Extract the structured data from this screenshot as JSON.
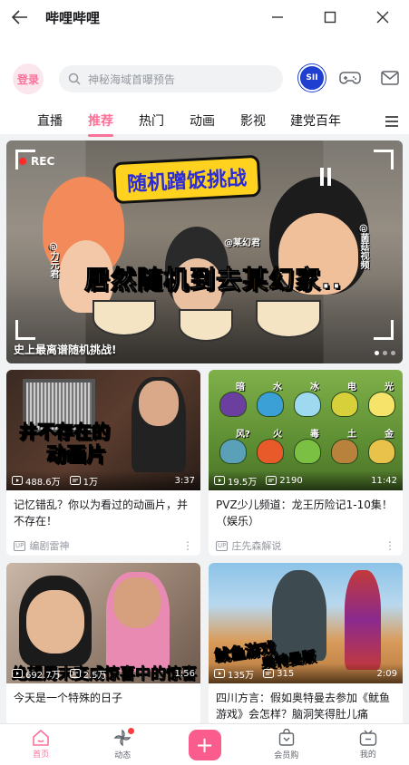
{
  "window": {
    "title": "哔哩哔哩"
  },
  "header": {
    "login_label": "登录",
    "search_placeholder": "神秘海域首曝预告",
    "avatar_label": "SII"
  },
  "tabs": [
    {
      "label": "直播"
    },
    {
      "label": "推荐"
    },
    {
      "label": "热门"
    },
    {
      "label": "动画"
    },
    {
      "label": "影视"
    },
    {
      "label": "建党百年"
    }
  ],
  "banner": {
    "rec_label": "REC",
    "headline": "随机蹭饭挑战",
    "big_text_part1": "居然随机到去",
    "big_text_highlight": "某幻",
    "big_text_part2": "家..",
    "name_tag_left": "@力元君",
    "name_tag_middle": "@某幻君",
    "name_tag_right": "@菌菇视频",
    "caption": "史上最离谱随机挑战!",
    "active_dot": 0,
    "dot_count": 3
  },
  "videos": [
    {
      "thumb_text_1": "井不存在的",
      "thumb_text_2": "动画片",
      "views": "488.6万",
      "comments": "1万",
      "duration": "3:37",
      "title": "记忆错乱？你以为看过的动画片，并不存在！",
      "uploader": "编剧雷神"
    },
    {
      "views": "19.5万",
      "comments": "2190",
      "duration": "11:42",
      "plant_labels": [
        "暗",
        "水",
        "冰",
        "电",
        "光",
        "风?",
        "火",
        "毒",
        "土",
        "金"
      ],
      "title": "PVZ少儿频道：龙王历险记1-10集！（娱乐）",
      "uploader": "庄先森解说"
    },
    {
      "thumb_text": "绝望周末变成惊喜中的惊喜",
      "views": "692.7万",
      "comments": "2.5万",
      "duration": "1:56",
      "title": "今天是一个特殊的日子",
      "uploader": ""
    },
    {
      "thumb_text_1": "鱿鱼游戏",
      "thumb_text_2": "奥特曼版",
      "views": "135万",
      "comments": "315",
      "duration": "2:09",
      "title": "四川方言：假如奥特曼去参加《鱿鱼游戏》会怎样？脑洞笑得肚儿痛",
      "uploader": ""
    }
  ],
  "bottom_nav": [
    {
      "label": "首页"
    },
    {
      "label": "动态"
    },
    {
      "label": "+"
    },
    {
      "label": "会员购"
    },
    {
      "label": "我的"
    }
  ],
  "colors": {
    "brand_pink": "#fb7299",
    "plus_pink": "#fb5c8e",
    "avatar_blue": "#1f3fd0"
  }
}
